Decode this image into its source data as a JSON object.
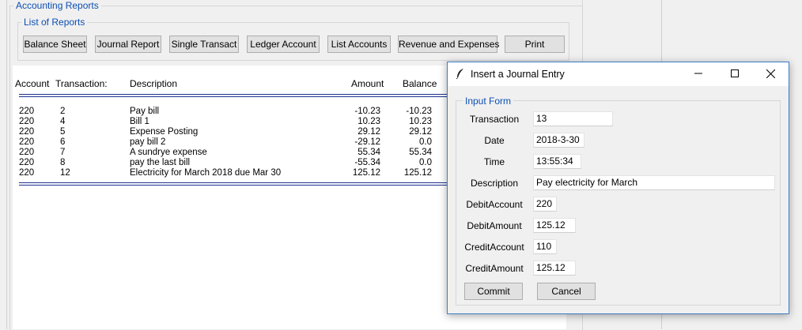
{
  "main": {
    "frame_title": "Accounting Reports",
    "reports_group_title": "List of Reports",
    "buttons": [
      "Balance Sheet",
      "Journal Report",
      "Single Transact",
      "Ledger Account",
      "List Accounts",
      "Revenue and Expenses",
      "Print"
    ],
    "columns": [
      "Account",
      "Transaction:",
      "Description",
      "Amount",
      "Balance"
    ],
    "rows": [
      {
        "account": "220",
        "transaction": "2",
        "description": "Pay bill",
        "amount": "-10.23",
        "balance": "-10.23"
      },
      {
        "account": "220",
        "transaction": "4",
        "description": "Bill 1",
        "amount": "10.23",
        "balance": "10.23"
      },
      {
        "account": "220",
        "transaction": "5",
        "description": "Expense Posting",
        "amount": "29.12",
        "balance": "29.12"
      },
      {
        "account": "220",
        "transaction": "6",
        "description": "pay bill 2",
        "amount": "-29.12",
        "balance": "0.0"
      },
      {
        "account": "220",
        "transaction": "7",
        "description": "A sundrye expense",
        "amount": "55.34",
        "balance": "55.34"
      },
      {
        "account": "220",
        "transaction": "8",
        "description": "pay the last bill",
        "amount": "-55.34",
        "balance": "0.0"
      },
      {
        "account": "220",
        "transaction": "12",
        "description": "Electricity for March 2018 due Mar 30",
        "amount": "125.12",
        "balance": "125.12"
      }
    ]
  },
  "dialog": {
    "title": "Insert a Journal Entry",
    "app_icon": "feather-icon",
    "group_title": "Input Form",
    "fields": [
      {
        "label": "Transaction",
        "value": "13"
      },
      {
        "label": "Date",
        "value": "2018-3-30"
      },
      {
        "label": "Time",
        "value": "13:55:34"
      },
      {
        "label": "Description",
        "value": "Pay electricity for March"
      },
      {
        "label": "DebitAccount",
        "value": "220"
      },
      {
        "label": "DebitAmount",
        "value": "125.12"
      },
      {
        "label": "CreditAccount",
        "value": "110"
      },
      {
        "label": "CreditAmount",
        "value": "125.12"
      }
    ],
    "commit_label": "Commit",
    "cancel_label": "Cancel",
    "title_buttons": [
      "minimize-icon",
      "maximize-icon",
      "close-icon"
    ]
  }
}
